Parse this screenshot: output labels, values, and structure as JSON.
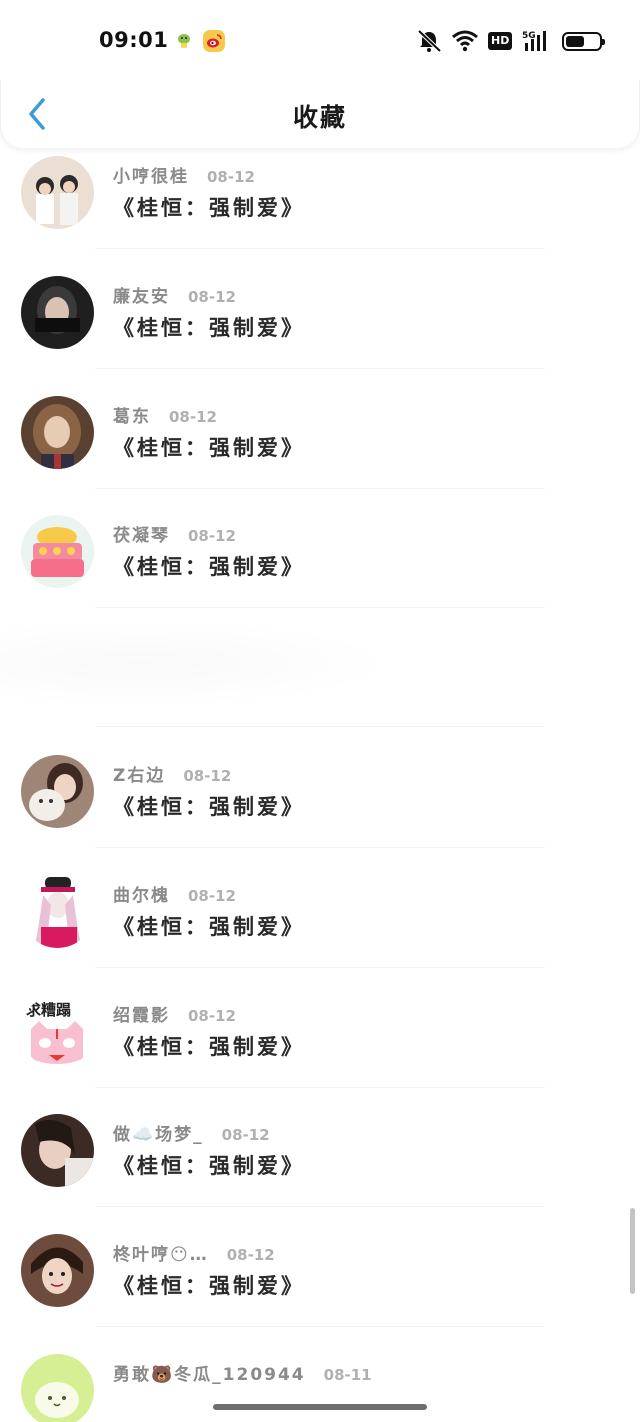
{
  "status": {
    "time": "09:01",
    "network": "5G",
    "hd": "HD",
    "battery_level": 0.55,
    "app_icons": [
      "lamp-app-icon",
      "weibo-icon"
    ]
  },
  "header": {
    "title": "收藏",
    "back_icon": "chevron-left-icon",
    "accent": "#3a9bd9"
  },
  "items": [
    {
      "user": "小哼很桂",
      "date": "08-12",
      "title": "《桂恒：强制爱》",
      "avatar_color": "#e6d8c8"
    },
    {
      "user": "廉友安",
      "date": "08-12",
      "title": "《桂恒：强制爱》",
      "avatar_color": "#2b2b2b"
    },
    {
      "user": "葛东",
      "date": "08-12",
      "title": "《桂恒：强制爱》",
      "avatar_color": "#7a5a3e"
    },
    {
      "user": "茯凝琴",
      "date": "08-12",
      "title": "《桂恒：强制爱》",
      "avatar_color": "#f4a3a3"
    },
    {
      "user": "Z右边",
      "date": "08-12",
      "title": "《桂恒：强制爱》",
      "avatar_color": "#c9a48a"
    },
    {
      "user": "曲尔槐",
      "date": "08-12",
      "title": "《桂恒：强制爱》",
      "avatar_color": "#f0e6ef"
    },
    {
      "user": "绍霞影",
      "date": "08-12",
      "title": "《桂恒：强制爱》",
      "avatar_color": "#f5e4ea"
    },
    {
      "user": "做☁️场梦_",
      "date": "08-12",
      "title": "《桂恒：强制爱》",
      "avatar_color": "#4a3a34"
    },
    {
      "user": "柊叶哼😶…",
      "date": "08-12",
      "title": "《桂恒：强制爱》",
      "avatar_color": "#5a3d2e"
    },
    {
      "user": "勇敢🐻冬瓜_120944",
      "date": "08-11",
      "title": "",
      "avatar_color": "#d8ef9a"
    }
  ]
}
